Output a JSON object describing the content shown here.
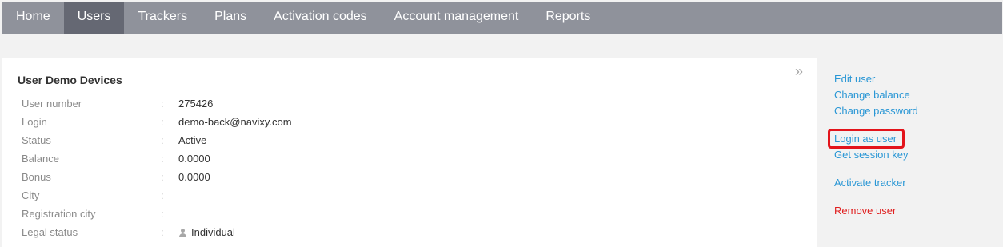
{
  "nav": {
    "items": [
      {
        "label": "Home",
        "active": false
      },
      {
        "label": "Users",
        "active": true
      },
      {
        "label": "Trackers",
        "active": false
      },
      {
        "label": "Plans",
        "active": false
      },
      {
        "label": "Activation codes",
        "active": false
      },
      {
        "label": "Account management",
        "active": false
      },
      {
        "label": "Reports",
        "active": false
      }
    ]
  },
  "card": {
    "title": "User Demo Devices",
    "collapse_glyph": "»",
    "separator": ":",
    "rows": [
      {
        "label": "User number",
        "value": "275426"
      },
      {
        "label": "Login",
        "value": "demo-back@navixy.com"
      },
      {
        "label": "Status",
        "value": "Active"
      },
      {
        "label": "Balance",
        "value": "0.0000"
      },
      {
        "label": "Bonus",
        "value": "0.0000"
      },
      {
        "label": "City",
        "value": ""
      },
      {
        "label": "Registration city",
        "value": ""
      },
      {
        "label": "Legal status",
        "value": "Individual",
        "icon": "person-icon"
      }
    ]
  },
  "actions": {
    "edit_user": "Edit user",
    "change_balance": "Change balance",
    "change_password": "Change password",
    "login_as_user": "Login as user",
    "get_session_key": "Get session key",
    "activate_tracker": "Activate tracker",
    "remove_user": "Remove user"
  },
  "colors": {
    "nav_bg": "#8f929b",
    "nav_active": "#656873",
    "link": "#2a97d5",
    "danger": "#e02020",
    "highlight": "#e3141b"
  }
}
